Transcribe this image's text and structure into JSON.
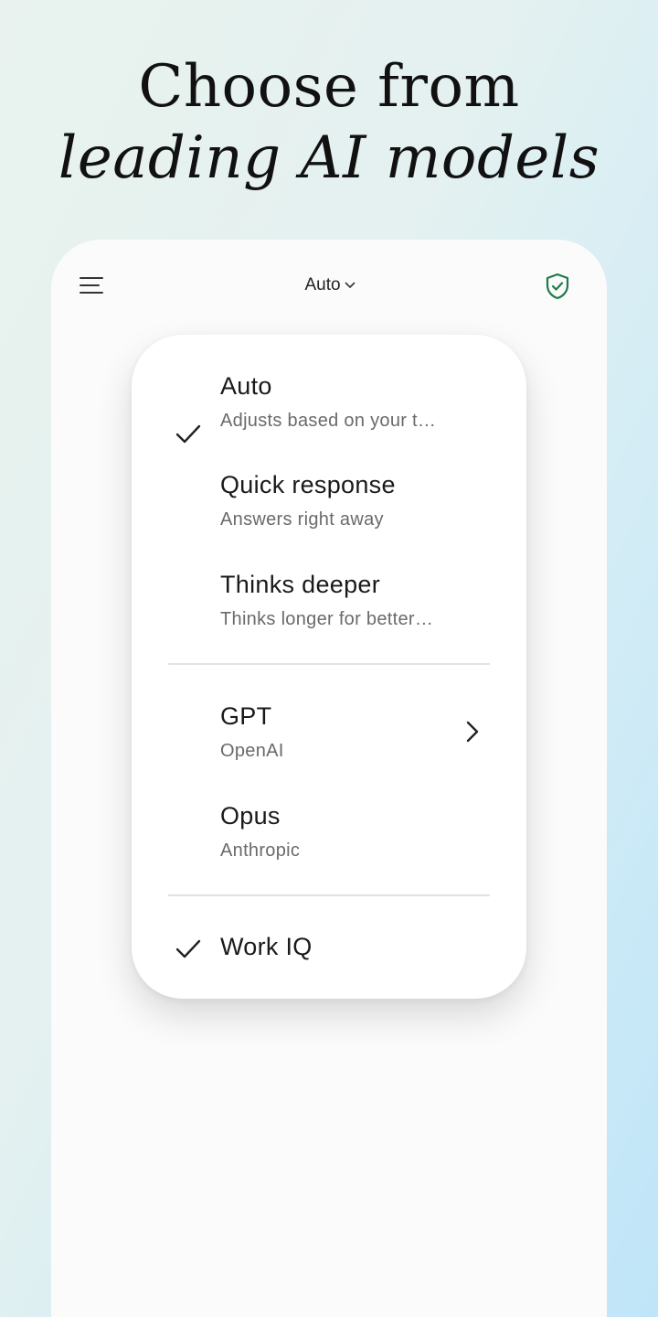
{
  "hero": {
    "line1": "Choose from",
    "line2": "leading AI models"
  },
  "topbar": {
    "title": "Auto",
    "menu_icon": "hamburger-menu-icon",
    "shield_icon": "shield-check-icon",
    "accent": "#1f7a4a"
  },
  "menu": {
    "items": [
      {
        "label": "Auto",
        "sub": "Adjusts based on your t…",
        "checked": true
      },
      {
        "label": "Quick response",
        "sub": "Answers right away",
        "checked": false
      },
      {
        "label": "Thinks deeper",
        "sub": "Thinks longer for better…",
        "checked": false
      },
      {
        "label": "GPT",
        "sub": "OpenAI",
        "checked": false,
        "has_submenu": true
      },
      {
        "label": "Opus",
        "sub": "Anthropic",
        "checked": false
      },
      {
        "label": "Work IQ",
        "checked": true
      }
    ]
  }
}
